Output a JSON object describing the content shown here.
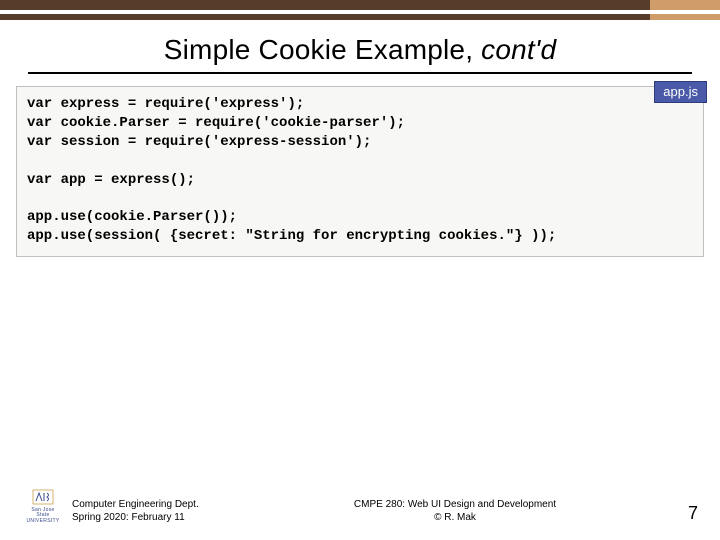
{
  "title_main": "Simple Cookie Example, ",
  "title_italic": "cont'd",
  "badge": "app.js",
  "code": "var express = require('express');\nvar cookie.Parser = require('cookie-parser');\nvar session = require('express-session');\n\nvar app = express();\n\napp.use(cookie.Parser());\napp.use(session( {secret: \"String for encrypting cookies.\"} ));",
  "footer": {
    "dept_line1": "Computer Engineering Dept.",
    "dept_line2": "Spring 2020: February 11",
    "course_line1": "CMPE 280: Web UI Design and Development",
    "course_line2": "© R. Mak",
    "logo_text1": "San Jose State",
    "logo_text2": "UNIVERSITY",
    "page": "7"
  }
}
